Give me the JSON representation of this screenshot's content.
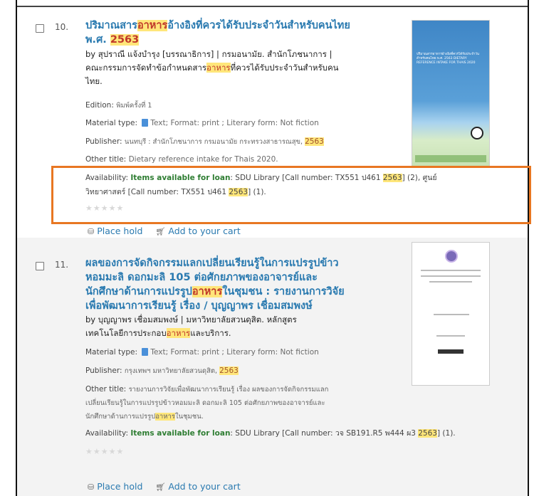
{
  "records": [
    {
      "number": "10.",
      "title_pre": "ปริมาณสาร",
      "title_hl": "อาหาร",
      "title_post": "อ้างอิงที่ควรได้รับประจำวันสำหรับคนไทย",
      "title_line2_pre": "พ.ศ. ",
      "title_line2_hl": "2563",
      "author_line1_by": "by ",
      "author_line1_name": "สุปราณี แจ้งบำรุง [บรรณาธิการ]",
      "author_line1_sep": " | ",
      "author_line1_org": "กรมอนามัย. สำนักโภชนาการ |",
      "author_line2_pre": "คณะกรรมการจัดทำข้อกำหนดสาร",
      "author_line2_hl": "อาหาร",
      "author_line2_post": "ที่ควรได้รับประจำวันสำหรับคน",
      "author_line3": "ไทย.",
      "edition_label": "Edition: ",
      "edition_value": "พิมพ์ครั้งที่ 1",
      "material_label": "Material type: ",
      "material_type": "Text",
      "material_rest": "; Format: print ; Literary form: Not fiction",
      "publisher_label": "Publisher: ",
      "publisher_value": "นนทบุรี : สำนักโภชนาการ กรมอนามัย กระทรวงสาธารณสุข, ",
      "publisher_year": "2563",
      "other_title_label": "Other title: ",
      "other_title_value": "Dietary reference intake for Thais 2020.",
      "availability_label": "Availability: ",
      "availability_status": "Items available for loan",
      "availability_l1a": ": SDU Library [Call number: TX551 ป461 ",
      "availability_l1_hl": "2563",
      "availability_l1b": "] (2), ศูนย์",
      "availability_l2a": "วิทยาศาสตร์ [Call number: TX551 ป461 ",
      "availability_l2_hl": "2563",
      "availability_l2b": "] (1).",
      "stars": "★★★★★",
      "place_hold": "Place hold",
      "add_cart": "Add to your cart",
      "cover_text": "ปริมาณสารอาหารอ้างอิงที่ควรได้รับประจำวัน สำหรับคนไทย พ.ศ. 2563 DIETARY REFERENCE INTAKE FOR THAIS 2020"
    },
    {
      "number": "11.",
      "t1": "ผลของการจัดกิจกรรมแลกเปลี่ยนเรียนรู้ในการแปรรูปข้าว",
      "t2": "หอมมะลิ ดอกมะลิ 105 ต่อศักยภาพของอาจารย์และ",
      "t3_pre": "นักศึกษาด้านการแปรรูป",
      "t3_hl": "อาหาร",
      "t3_post": "ในชุมชน : รายงานการวิจัย",
      "t4": "เพื่อพัฒนาการเรียนรู้ เรื่อง / บุญญาพร เชื่อมสมพงษ์",
      "author_by": "by ",
      "author_name": "บุญญาพร เชื่อมสมพงษ์",
      "author_sep": " | ",
      "author_org": "มหาวิทยาลัยสวนดุสิต. หลักสูตร",
      "author_l2_pre": "เทคโนโลยีการประกอบ",
      "author_l2_hl": "อาหาร",
      "author_l2_post": "และบริการ.",
      "material_label": "Material type: ",
      "material_type": "Text",
      "material_rest": "; Format: print ; Literary form: Not fiction",
      "publisher_label": "Publisher: ",
      "publisher_value": "กรุงเทพฯ มหาวิทยาลัยสวนดุสิต, ",
      "publisher_year": "2563",
      "other_title_label": "Other title: ",
      "ot1": "รายงานการวิจัยเพื่อพัฒนาการเรียนรู้ เรื่อง ผลของการจัดกิจกรรมแลก",
      "ot2": "เปลี่ยนเรียนรู้ในการแปรรูปข้าวหอมมะลิ ดอกมะลิ 105 ต่อศักยภาพของอาจารย์และ",
      "ot3_pre": "นักศึกษาด้านการแปรรูป",
      "ot3_hl": "อาหาร",
      "ot3_post": "ในชุมชน.",
      "availability_label": "Availability: ",
      "availability_status": "Items available for loan",
      "availability_a": ": SDU Library [Call number: วจ SB191.R5 พ444 ผ3 ",
      "availability_hl": "2563",
      "availability_b": "] (1).",
      "stars": "★★★★★",
      "place_hold": "Place hold",
      "add_cart": "Add to your cart"
    }
  ],
  "icons": {
    "hold": "hold-icon",
    "cart": "cart-icon",
    "type": "text-type-icon"
  },
  "colors": {
    "link": "#2a7ab0",
    "highlight": "#ffe67a",
    "highlight_text": "#c0392b",
    "available": "#2e7d32",
    "callout": "#e87722"
  }
}
